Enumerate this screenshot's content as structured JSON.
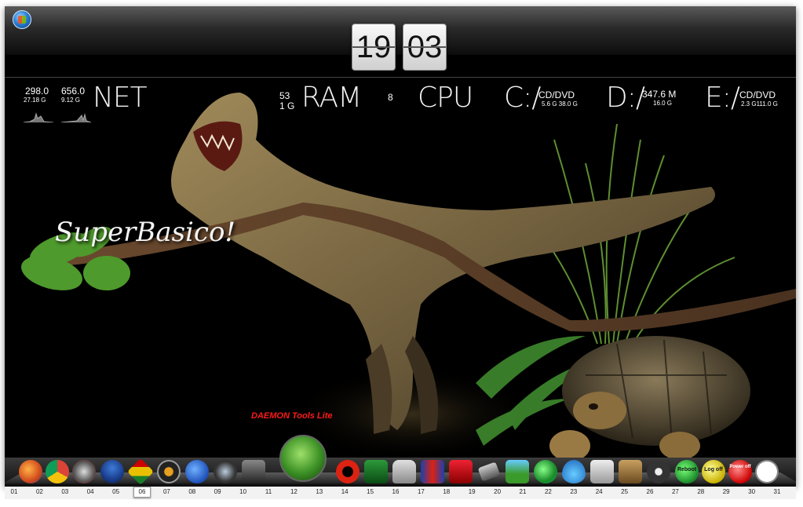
{
  "clock": {
    "hours": "19",
    "minutes": "03"
  },
  "net": {
    "label": "NET",
    "up_rate": "298.0",
    "down_rate": "656.0",
    "up_total": "27.18 G",
    "down_total": "9.12 G"
  },
  "ram": {
    "label": "RAM",
    "value": "53",
    "total": "1 G"
  },
  "cpu": {
    "label": "CPU",
    "value": "8"
  },
  "drive_c": {
    "label": "C:/",
    "type": "CD/DVD",
    "info": "5.6 G 38.0 G"
  },
  "drive_d": {
    "label": "D:/",
    "size": "347.6 M",
    "info": "16.0 G"
  },
  "drive_e": {
    "label": "E:/",
    "type": "CD/DVD",
    "info": "2.3 G111.0 G"
  },
  "wallpaper": {
    "watermark": "SuperBasico!"
  },
  "dock": {
    "tooltip": "DAEMON Tools Lite",
    "reboot_label": "Reboot",
    "logoff_label": "Log off",
    "poweroff_label": "Power off",
    "numbers": [
      "01",
      "02",
      "03",
      "04",
      "05",
      "06",
      "07",
      "08",
      "09",
      "10",
      "11",
      "12",
      "13",
      "14",
      "15",
      "16",
      "17",
      "18",
      "19",
      "20",
      "21",
      "22",
      "23",
      "24",
      "25",
      "26",
      "27",
      "28",
      "29",
      "30",
      "31"
    ],
    "active_number": "06"
  },
  "icons": {
    "start": "windows-start-orb",
    "items": [
      "firefox-icon",
      "chrome-icon",
      "media-icon",
      "messenger-icon",
      "cube-icon",
      "speaker-icon",
      "play-icon",
      "webcam-icon",
      "camera-icon",
      "daemon-tools-icon",
      "ccleaner-icon",
      "network-icon",
      "lock-icon",
      "books-icon",
      "store-icon",
      "phone-icon",
      "landscape-icon",
      "globe-icon",
      "water-drop-icon",
      "drive-icon",
      "package-icon",
      "power-icon",
      "reboot-icon",
      "logoff-icon",
      "poweroff-icon",
      "clock-icon"
    ]
  }
}
